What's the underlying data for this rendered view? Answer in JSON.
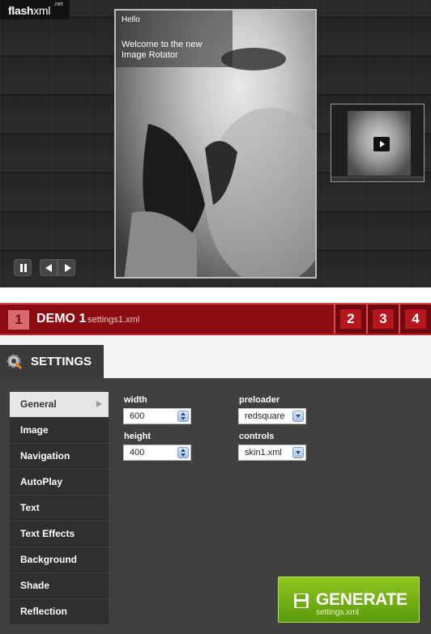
{
  "logo": {
    "brand_bold": "flash",
    "brand_light": "xml",
    "tld": ".net"
  },
  "rotator": {
    "caption_title": "Hello",
    "caption_body": "Welcome to the new Image Rotator",
    "controls": {
      "pause_icon": "pause-icon",
      "prev_icon": "arrow-left-icon",
      "next_icon": "arrow-right-icon"
    }
  },
  "demo": {
    "current_number": "1",
    "title": "DEMO 1",
    "file": "settings1.xml",
    "tabs": [
      "2",
      "3",
      "4"
    ],
    "colors": {
      "bar": "#8b0d12",
      "tab": "#b6161c"
    }
  },
  "settings": {
    "title": "SETTINGS",
    "menu": [
      "General",
      "Image",
      "Navigation",
      "AutoPlay",
      "Text",
      "Text Effects",
      "Background",
      "Shade",
      "Reflection"
    ],
    "active_menu": "General",
    "fields": {
      "width": {
        "label": "width",
        "value": "600"
      },
      "height": {
        "label": "height",
        "value": "400"
      },
      "preloader": {
        "label": "preloader",
        "value": "redsquare"
      },
      "controls": {
        "label": "controls",
        "value": "skin1.xml"
      }
    }
  },
  "generate": {
    "label": "GENERATE",
    "sub": "settings.xml",
    "color": "#6fae12"
  }
}
